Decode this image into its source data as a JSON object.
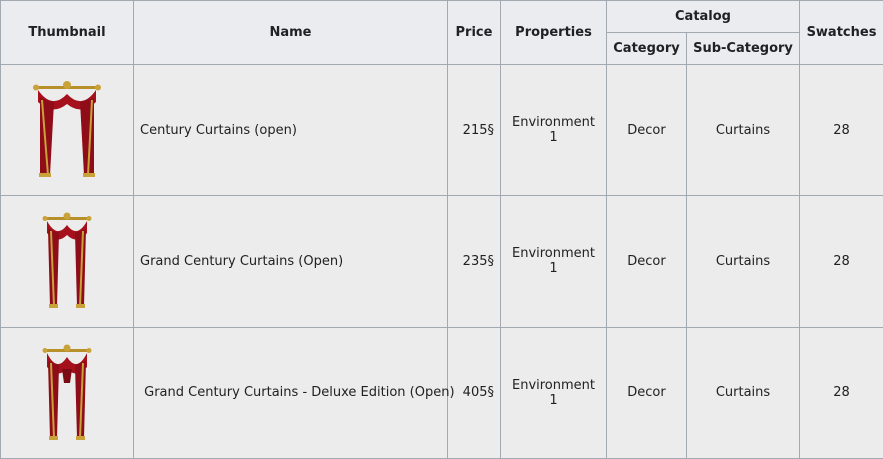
{
  "table": {
    "headers": {
      "thumbnail": "Thumbnail",
      "name": "Name",
      "price": "Price",
      "properties": "Properties",
      "catalog": "Catalog",
      "category": "Category",
      "subcategory": "Sub-Category",
      "swatches": "Swatches"
    },
    "rows": [
      {
        "thumbnail_icon": "red-curtain-icon",
        "name": "Century Curtains (open)",
        "price": "215§",
        "properties": "Environment 1",
        "category": "Decor",
        "subcategory": "Curtains",
        "swatches": "28"
      },
      {
        "thumbnail_icon": "red-curtain-icon",
        "name": "Grand Century Curtains (Open)",
        "price": "235§",
        "properties": "Environment 1",
        "category": "Decor",
        "subcategory": "Curtains",
        "swatches": "28"
      },
      {
        "thumbnail_icon": "red-curtain-icon",
        "name": " Grand Century Curtains - Deluxe Edition (Open)",
        "price": "405§",
        "properties": "Environment 1",
        "category": "Decor",
        "subcategory": "Curtains",
        "swatches": "28"
      }
    ]
  },
  "colors": {
    "header_bg": "#eaecf0",
    "cell_bg": "#ececec",
    "border": "#a2a9b1",
    "curtain_red": "#a5101c",
    "curtain_gold": "#b8902a"
  }
}
